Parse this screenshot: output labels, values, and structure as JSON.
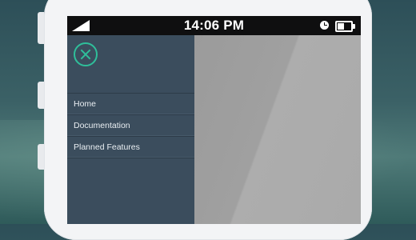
{
  "status_bar": {
    "time": "14:06 PM",
    "signal_icon": "signal-icon",
    "clock_icon": "clock-icon",
    "battery_icon": "battery-icon",
    "battery_level": 0.5
  },
  "drawer": {
    "close_icon": "close-icon",
    "items": [
      {
        "label": "Home"
      },
      {
        "label": "Documentation"
      },
      {
        "label": "Planned Features"
      }
    ]
  },
  "colors": {
    "accent": "#2fbf9a",
    "drawer_bg": "#3b4d5d",
    "status_bar_bg": "#0f0f10",
    "content_bg": "#a0a0a0"
  }
}
